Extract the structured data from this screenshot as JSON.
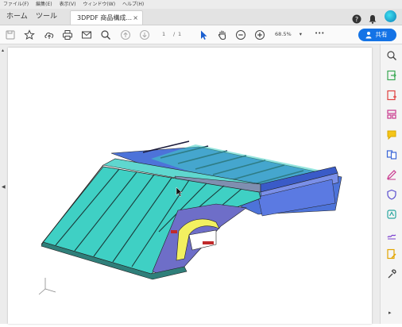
{
  "menu": [
    "ファイル(F)",
    "編集(E)",
    "表示(V)",
    "ウィンドウ(W)",
    "ヘルプ(H)"
  ],
  "tabs": {
    "home": "ホーム",
    "tools": "ツール",
    "document": "3DPDF 商品構成...",
    "close": "×"
  },
  "toolbar": {
    "page_current": "1",
    "page_sep": "/",
    "page_total": "1",
    "zoom": "68.5%",
    "zoom_caret": "▾",
    "more": "•••",
    "share_label": "共有"
  },
  "colors": {
    "accent": "#1473e6",
    "roof_panel": "#3fd0c4",
    "roof_top": "#5a7de0",
    "trim_yellow": "#f2f060",
    "side_purple": "#6e6ec8"
  },
  "sidebar_icons": [
    "zoom-search-icon",
    "export-pdf-icon",
    "create-pdf-icon",
    "organize-pages-icon",
    "comment-icon",
    "combine-files-icon",
    "fill-sign-icon",
    "protect-icon",
    "enhance-scans-icon",
    "sign-icon",
    "edit-pdf-icon",
    "more-tools-icon"
  ]
}
